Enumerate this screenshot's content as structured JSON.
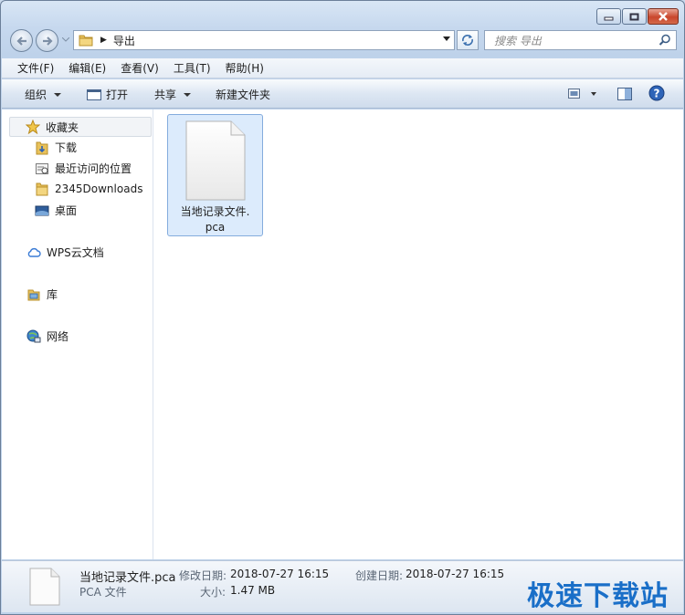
{
  "window": {
    "caption_buttons": [
      "minimize",
      "maximize",
      "close"
    ]
  },
  "address_bar": {
    "crumb": "导出"
  },
  "search": {
    "placeholder": "搜索 导出"
  },
  "menu": {
    "items": [
      "文件(F)",
      "编辑(E)",
      "查看(V)",
      "工具(T)",
      "帮助(H)"
    ]
  },
  "toolbar": {
    "organize": "组织",
    "open": "打开",
    "share": "共享",
    "new_folder": "新建文件夹"
  },
  "navpane": {
    "favorites": "收藏夹",
    "favorites_items": [
      "下载",
      "最近访问的位置",
      "2345Downloads",
      "桌面"
    ],
    "wps": "WPS云文档",
    "library": "库",
    "network": "网络"
  },
  "files": [
    {
      "name": "当地记录文件.pca",
      "name_line1": "当地记录文件.",
      "name_line2": "pca",
      "selected": true
    }
  ],
  "details": {
    "filename": "当地记录文件.pca",
    "type": "PCA 文件",
    "modified_label": "修改日期:",
    "modified_value": "2018-07-27 16:15",
    "created_label": "创建日期:",
    "created_value": "2018-07-27 16:15",
    "size_label": "大小:",
    "size_value": "1.47 MB"
  },
  "watermark": "极速下载站",
  "colors": {
    "selection_fill": "#dcebfc",
    "selection_border": "#84acdd",
    "watermark": "#1a6fc8"
  }
}
